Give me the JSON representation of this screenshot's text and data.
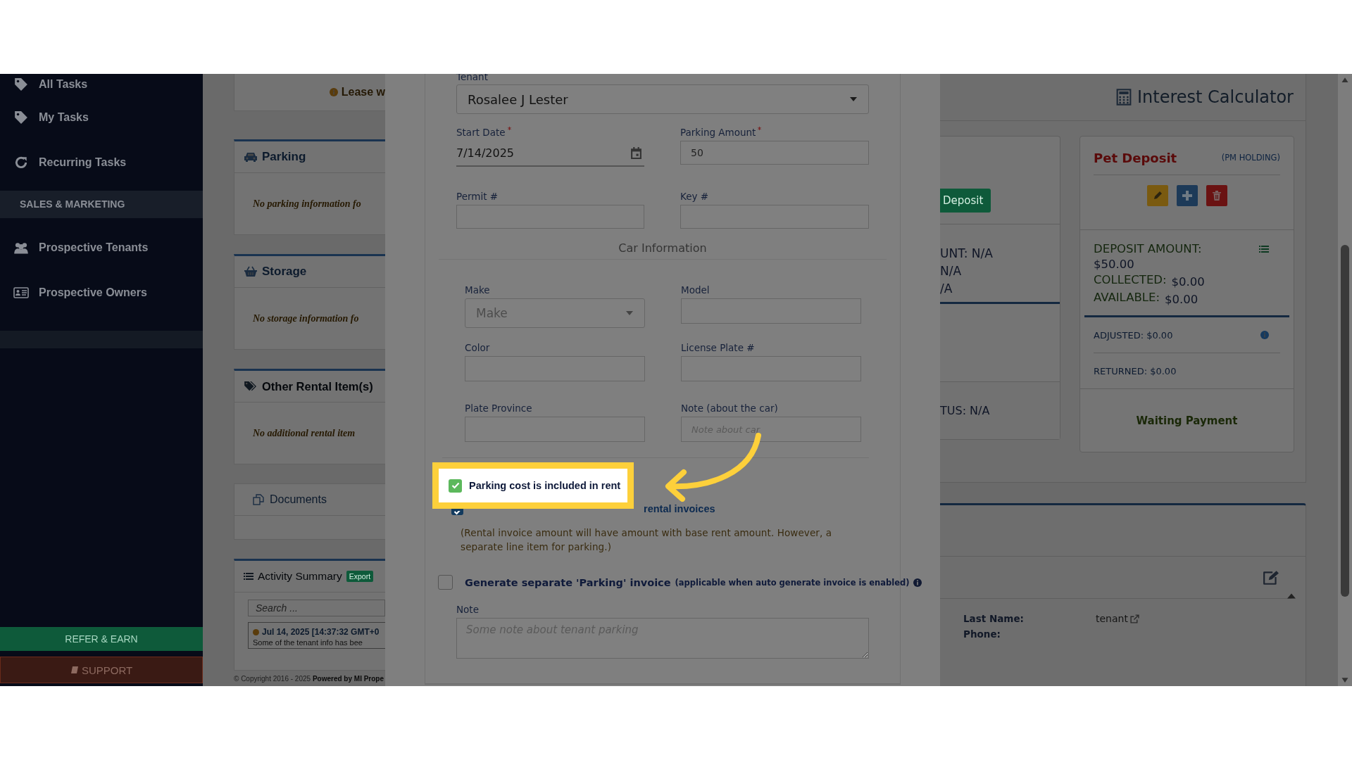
{
  "sidebar": {
    "items": [
      {
        "kind": "item",
        "label": "All Tasks"
      },
      {
        "kind": "item",
        "label": "My Tasks"
      },
      {
        "kind": "item",
        "label": "Recurring Tasks"
      },
      {
        "kind": "section",
        "label": "SALES & MARKETING"
      },
      {
        "kind": "item",
        "label": "Prospective Tenants"
      },
      {
        "kind": "item",
        "label": "Prospective Owners"
      }
    ],
    "buttons": [
      {
        "kind": "refer",
        "label": "REFER & EARN"
      },
      {
        "kind": "support",
        "label": "SUPPORT"
      }
    ]
  },
  "lease_notice": "Lease w",
  "panels": [
    {
      "title": "Parking",
      "message": "No parking information fo"
    },
    {
      "title": "Storage",
      "message": "No storage information fo"
    },
    {
      "title": "Other Rental Item(s)",
      "message": "No additional rental item"
    },
    {
      "title": "Documents"
    }
  ],
  "activity": {
    "title": "Activity Summary",
    "badge": "Export",
    "search": {
      "placeholder": "Search ..."
    },
    "entry_time": "Jul 14, 2025 [14:37:32 GMT+0",
    "entry_text": "Some of the tenant info has bee"
  },
  "footer": "© Copyright 2016 - 2025 **Powered by MI Prope**",
  "modal": {
    "tenant": {
      "label": "Tenant",
      "value": "Rosalee J Lester"
    },
    "start_date": {
      "label": "Start Date",
      "required": true,
      "value": "7/14/2025"
    },
    "parking_amount": {
      "label": "Parking Amount",
      "required": true,
      "value": "50"
    },
    "permit": {
      "label": "Permit #"
    },
    "key": {
      "label": "Key #"
    },
    "car_section": "Car Information",
    "make": {
      "label": "Make",
      "placeholder": "Make"
    },
    "model": {
      "label": "Model"
    },
    "color": {
      "label": "Color"
    },
    "license_plate": {
      "label": "License Plate #"
    },
    "plate_province": {
      "label": "Plate Province"
    },
    "car_note": {
      "label": "Note (about the car)",
      "placeholder": "Note about car"
    },
    "options": [
      {
        "label": "Parking cost is included in rent",
        "checked": true,
        "highlighted": true
      },
      {
        "label": "rental invoices",
        "checked": true,
        "highlighted": false
      }
    ],
    "hint": "(Rental invoice amount will have amount with base rent amount. However, a separate line item for parking.)",
    "generate": {
      "label": "Generate separate 'Parking' invoice",
      "note": "(applicable when auto generate invoice is enabled)",
      "checked": false
    },
    "note": {
      "label": "Note",
      "placeholder": "Some note about tenant parking"
    }
  },
  "interest_calculator": "Interest Calculator",
  "deposit_card": {
    "button": "Deposit",
    "lines": [
      "UNT: N/A",
      "N/A",
      "/A"
    ],
    "status": "TUS: N/A"
  },
  "pet_deposit": {
    "title": "Pet Deposit",
    "holding": "(PM HOLDING)",
    "amount_label": "DEPOSIT AMOUNT:",
    "amount": "$50.00",
    "collected_label": "COLLECTED:",
    "collected": "$0.00",
    "available_label": "AVAILABLE:",
    "available": "$0.00",
    "adjusted": "ADJUSTED: $0.00",
    "returned": "RETURNED: $0.00",
    "status": "Waiting Payment"
  },
  "tenant_info": [
    {
      "label": "Last Name:",
      "value": "tenant"
    },
    {
      "label": "Phone:"
    }
  ]
}
